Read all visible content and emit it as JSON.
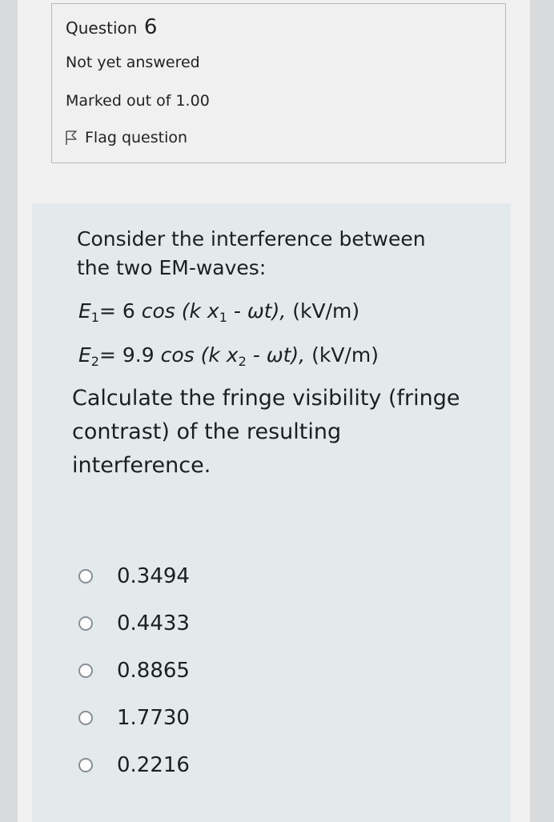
{
  "info": {
    "question_label": "Question",
    "question_number": "6",
    "state": "Not yet answered",
    "marked_out_of": "Marked out of 1.00",
    "flag_label": "Flag question"
  },
  "question": {
    "line1": "Consider the interference between",
    "line2": "the two EM-waves:",
    "eq1": {
      "lhs": "E",
      "lhs_sub": "1",
      "rhs_start": "= 6 ",
      "cos": "cos (k x",
      "x_sub": "1",
      "mid": " - ωt),",
      "unit": " (kV/m)"
    },
    "eq2": {
      "lhs": "E",
      "lhs_sub": "2",
      "rhs_start": "= 9.9 ",
      "cos": "cos (k x",
      "x_sub": "2",
      "mid": " - ωt),",
      "unit": " (kV/m)"
    },
    "line3": "Calculate the fringe visibility (fringe",
    "line4": "contrast) of the resulting",
    "line5": "interference."
  },
  "options": [
    {
      "label": "0.3494"
    },
    {
      "label": "0.4433"
    },
    {
      "label": "0.8865"
    },
    {
      "label": "1.7730"
    },
    {
      "label": "0.2216"
    }
  ],
  "icons": {
    "flag": "flag-icon"
  },
  "colors": {
    "background": "#d9dadb",
    "info_box": "#f0f0f0",
    "question_box": "#e3eaec",
    "text": "#1c1f22"
  }
}
